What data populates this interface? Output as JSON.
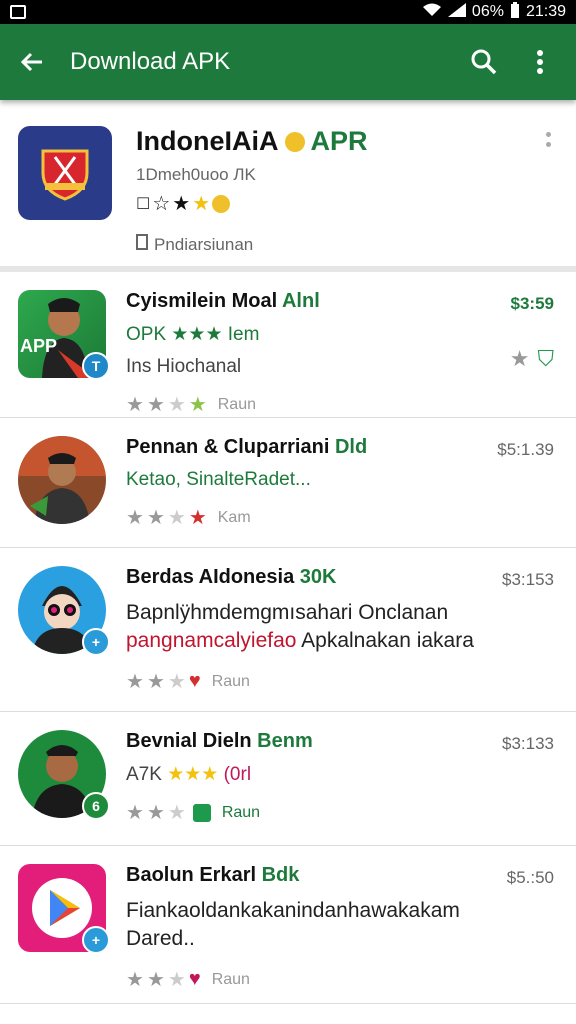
{
  "status_bar": {
    "battery": "06%",
    "time": "21:39"
  },
  "app_bar": {
    "title": "Download APK"
  },
  "header": {
    "title": "IndoneIAiA",
    "title_accent": "APR",
    "subtitle": "1Dmeh0uoo ЛK",
    "meta": "Pndiarsiunan"
  },
  "items": [
    {
      "title": "Cyismilein Moal",
      "title_tag": "Alnl",
      "line1": "OPK ★★★ Iem",
      "line2": "Ins Hiochanal",
      "rating_label": "Raun",
      "price": "$3:59",
      "badge": "T"
    },
    {
      "title": "Pennan & Cluparriani",
      "title_tag": "Dld",
      "line1": "Ketao, SinalteRadet...",
      "rating_label": "Kam",
      "price": "$5:1.39"
    },
    {
      "title": "Berdas AIdonesia",
      "title_tag": "30K",
      "desc1": "Bapnlÿhmdemgmısahari Onclanan",
      "desc2_red": "pangnamcalyiefao",
      "desc2_rest": " Apkalnakan iakara",
      "rating_label": "Rаun",
      "price": "$3:153",
      "badge": "+"
    },
    {
      "title": "Bevnial Dieln",
      "title_tag": "Benm",
      "line1_prefix": "A7K",
      "line1_suffix": "(0rl",
      "rating_label": "Raun",
      "price": "$3:133",
      "badge": "6"
    },
    {
      "title": "Baolun Erkarl",
      "title_tag": "Bdk",
      "desc1": "Fiankaoldankakanindanhawakakam",
      "desc2": "Dared..",
      "rating_label": "Raun",
      "price": "$5.:50",
      "badge": "+"
    }
  ]
}
